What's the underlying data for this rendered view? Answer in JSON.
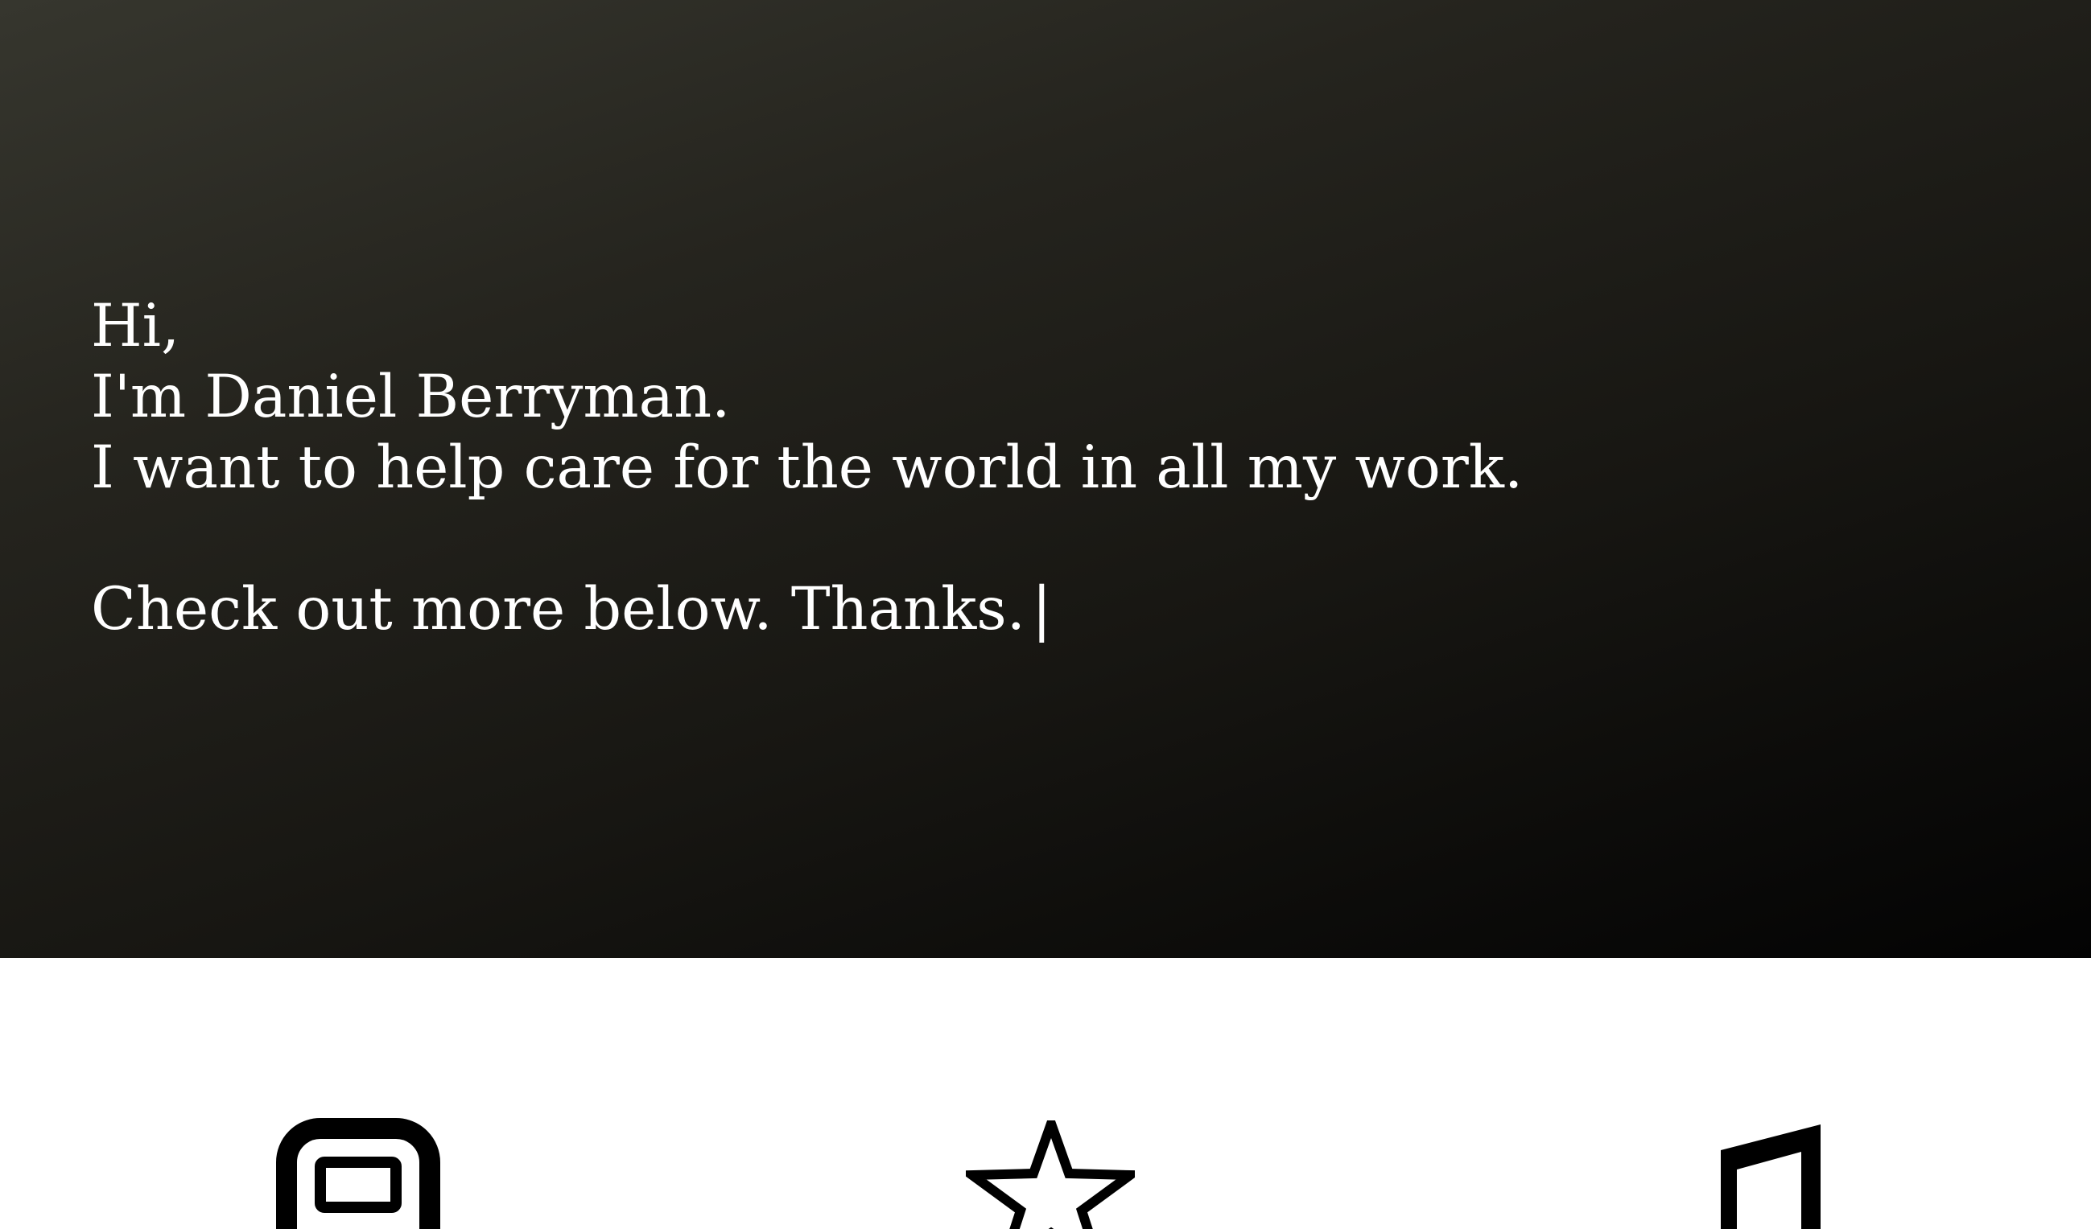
{
  "hero": {
    "greeting": "Hi,",
    "intro": "I'm Daniel Berryman.",
    "mission": "I want to help care for the world in all my work.",
    "call_to_action": "Check out more below. Thanks.",
    "cursor": "|"
  },
  "features": [
    {
      "icon": "device-icon"
    },
    {
      "icon": "star-icon"
    },
    {
      "icon": "music-note-icon"
    }
  ],
  "colors": {
    "hero_gradient_start": "#36362e",
    "hero_gradient_end": "#030303",
    "hero_text": "#ffffff",
    "icon": "#000000",
    "section_background": "#ffffff"
  }
}
